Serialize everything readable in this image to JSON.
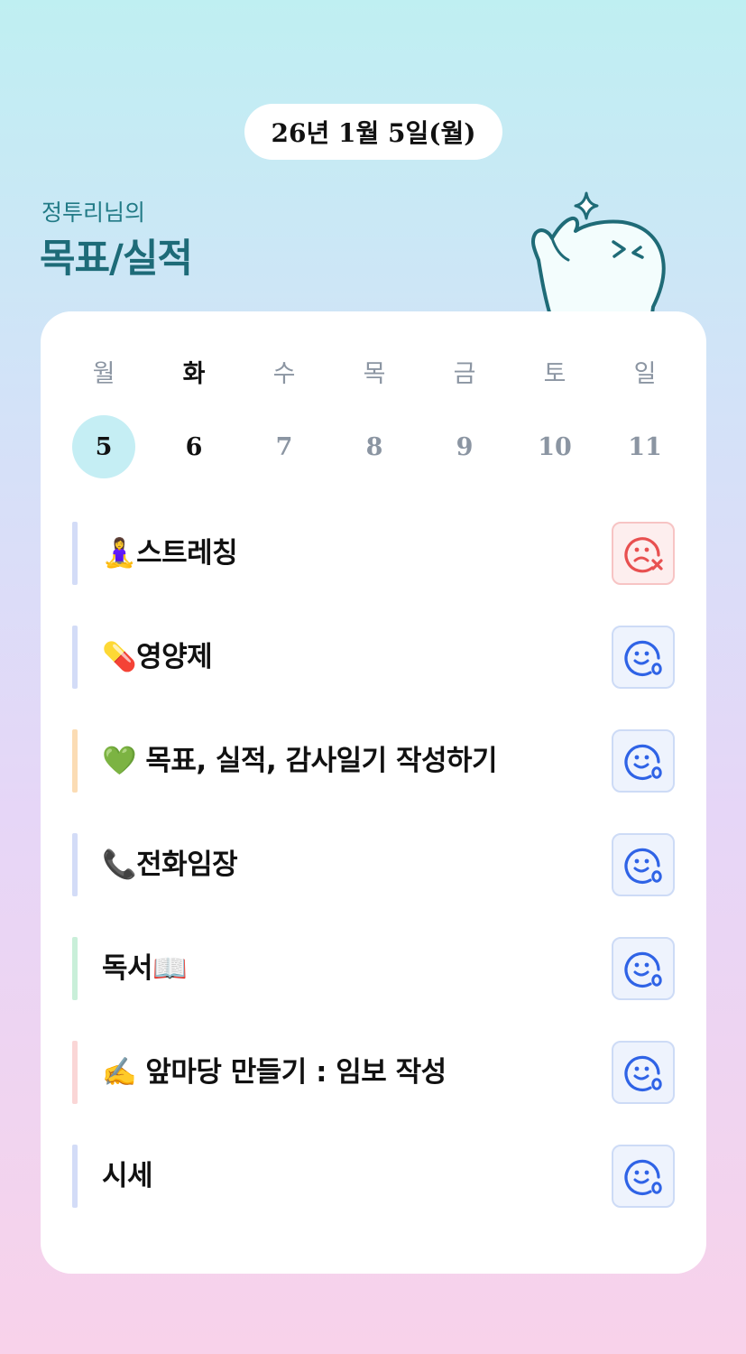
{
  "header": {
    "date": "26년 1월 5일(월)",
    "owner": "정투리님의",
    "title": "목표/실적"
  },
  "week": {
    "weekdays": [
      "월",
      "화",
      "수",
      "목",
      "금",
      "토",
      "일"
    ],
    "days": [
      "5",
      "6",
      "7",
      "8",
      "9",
      "10",
      "11"
    ],
    "selected_index": 0
  },
  "colors": {
    "accent": "#1d6b78",
    "selected_day": "#c5eef4",
    "success_icon": "#2f63e6",
    "fail_icon": "#e85050"
  },
  "tasks": [
    {
      "label": "🧘‍♀️스트레칭",
      "bar_color": "#d3dcf7",
      "status": "fail",
      "icon": "sad-face-x-icon"
    },
    {
      "label": "💊영양제",
      "bar_color": "#d3dcf7",
      "status": "done",
      "icon": "smile-face-icon"
    },
    {
      "label": "💚 목표, 실적, 감사일기 작성하기",
      "bar_color": "#fbdcb4",
      "status": "done",
      "icon": "smile-face-icon"
    },
    {
      "label": "📞전화임장",
      "bar_color": "#d3dcf7",
      "status": "done",
      "icon": "smile-face-icon"
    },
    {
      "label": "독서📖",
      "bar_color": "#c9efd9",
      "status": "done",
      "icon": "smile-face-icon"
    },
    {
      "label": "✍️ 앞마당 만들기 : 임보 작성",
      "bar_color": "#fad6d6",
      "status": "done",
      "icon": "smile-face-icon"
    },
    {
      "label": "시세",
      "bar_color": "#d3dcf7",
      "status": "done",
      "icon": "smile-face-icon"
    }
  ]
}
